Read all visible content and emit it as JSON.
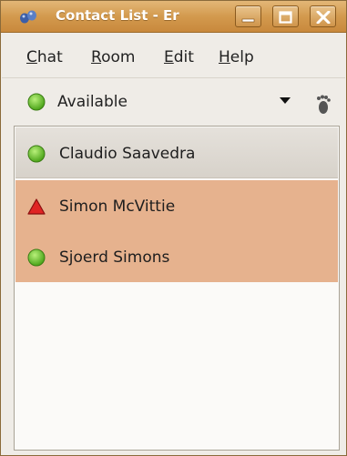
{
  "window": {
    "title": "Contact List - Er",
    "icon": "empathy-feet-icon"
  },
  "menu": {
    "items": [
      {
        "label": "Chat",
        "mnemonic": "C",
        "rest": "hat"
      },
      {
        "label": "Room",
        "mnemonic": "R",
        "rest": "oom"
      },
      {
        "label": "Edit",
        "mnemonic": "E",
        "rest": "dit"
      },
      {
        "label": "Help",
        "mnemonic": "H",
        "rest": "elp"
      }
    ]
  },
  "presence": {
    "status": "Available",
    "status_color": "#6dc82d",
    "icons": [
      "dropdown-caret-icon",
      "gnome-foot-icon"
    ]
  },
  "contacts": [
    {
      "name": "Claudio Saavedra",
      "status": "available",
      "icon": "available-dot-icon",
      "color": "#6dc82d"
    },
    {
      "name": "Simon McVittie",
      "status": "error",
      "icon": "warning-triangle-icon",
      "color": "#d62020"
    },
    {
      "name": "Sjoerd Simons",
      "status": "available",
      "icon": "available-dot-icon",
      "color": "#6dc82d"
    }
  ],
  "colors": {
    "titlebar": "#d39a4e",
    "selected_row": "#e6b28e"
  }
}
